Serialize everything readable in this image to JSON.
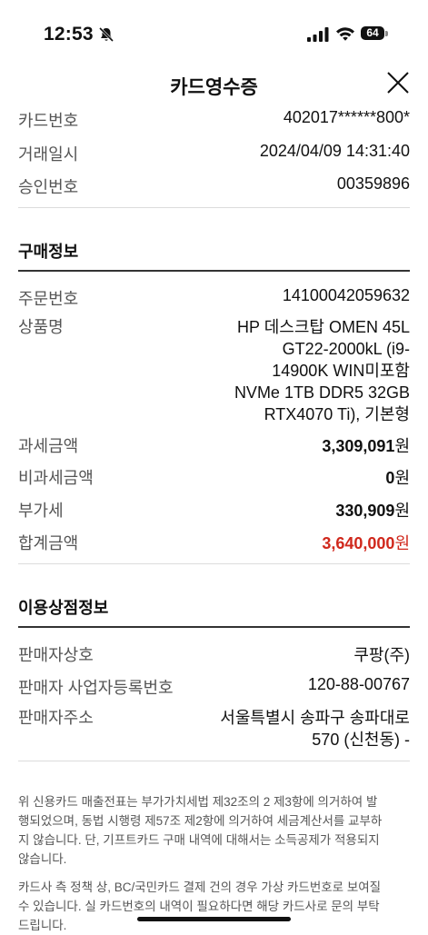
{
  "status": {
    "time": "12:53",
    "battery": "64"
  },
  "header": {
    "title": "카드영수증"
  },
  "card": [
    {
      "label": "카드번호",
      "value": "402017******800*"
    },
    {
      "label": "거래일시",
      "value": "2024/04/09 14:31:40"
    },
    {
      "label": "승인번호",
      "value": "00359896"
    }
  ],
  "purchase": {
    "heading": "구매정보",
    "order_label": "주문번호",
    "order_value": "14100042059632",
    "product_label": "상품명",
    "product_lines": [
      "HP 데스크탑 OMEN 45L",
      "GT22-2000kL (i9-",
      "14900K WIN미포함",
      "NVMe 1TB DDR5 32GB",
      "RTX4070 Ti), 기본형"
    ],
    "taxable_label": "과세금액",
    "taxable_value": "3,309,091",
    "nontax_label": "비과세금액",
    "nontax_value": "0",
    "vat_label": "부가세",
    "vat_value": "330,909",
    "total_label": "합계금액",
    "total_value": "3,640,000",
    "currency": "원"
  },
  "merchant": {
    "heading": "이용상점정보",
    "name_label": "판매자상호",
    "name_value": "쿠팡(주)",
    "reg_label": "판매자 사업자등록번호",
    "reg_value": "120-88-00767",
    "addr_label": "판매자주소",
    "addr_lines": [
      "서울특별시 송파구 송파대로",
      "570 (신천동) -"
    ]
  },
  "notices": [
    [
      "위 신용카드 매출전표는 부가가치세법 제32조의 2 제3항에 의거하여 발",
      "행되었으며, 동법 시행령 제57조 제2항에 의거하여 세금계산서를 교부하",
      "지 않습니다. 단, 기프트카드 구매 내역에 대해서는 소득공제가 적용되지",
      "않습니다."
    ],
    [
      "카드사 측 정책 상, BC/국민카드 결제 건의 경우 가상 카드번호로 보여질",
      "수 있습니다. 실 카드번호의 내역이 필요하다면 해당 카드사로 문의 부탁",
      "드립니다."
    ]
  ]
}
